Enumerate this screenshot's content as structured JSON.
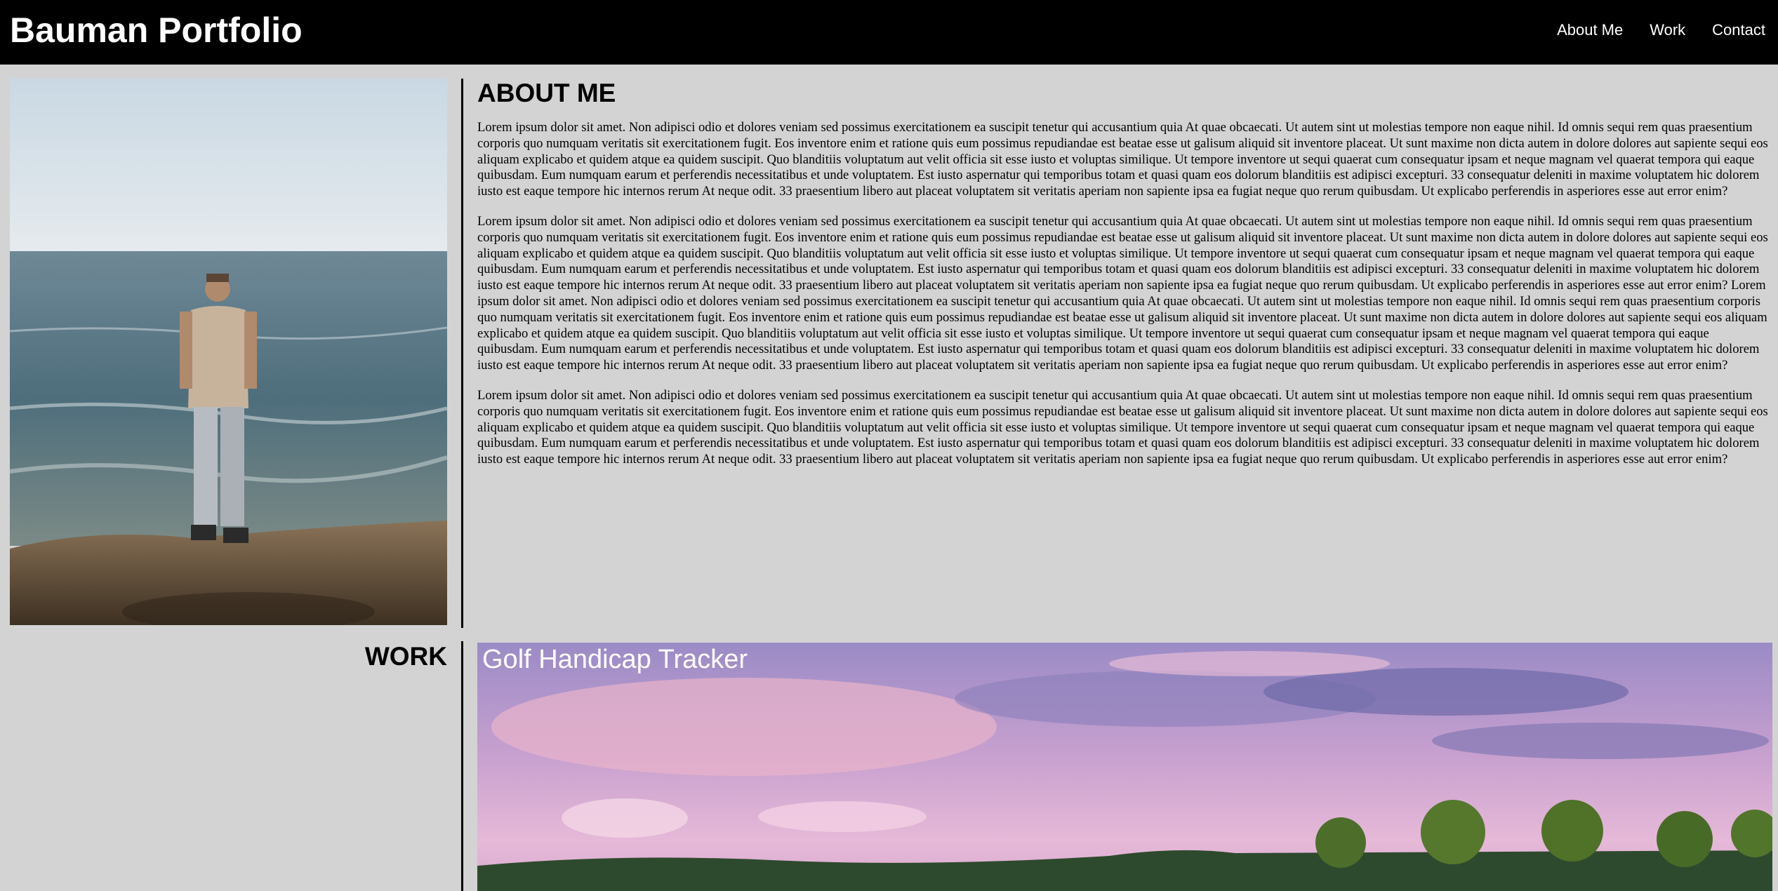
{
  "header": {
    "title": "Bauman Portfolio",
    "nav": [
      "About Me",
      "Work",
      "Contact"
    ]
  },
  "about": {
    "heading": "ABOUT ME",
    "paragraphs": [
      "Lorem ipsum dolor sit amet. Non adipisci odio et dolores veniam sed possimus exercitationem ea suscipit tenetur qui accusantium quia At quae obcaecati. Ut autem sint ut molestias tempore non eaque nihil. Id omnis sequi rem quas praesentium corporis quo numquam veritatis sit exercitationem fugit. Eos inventore enim et ratione quis eum possimus repudiandae est beatae esse ut galisum aliquid sit inventore placeat. Ut sunt maxime non dicta autem in dolore dolores aut sapiente sequi eos aliquam explicabo et quidem atque ea quidem suscipit. Quo blanditiis voluptatum aut velit officia sit esse iusto et voluptas similique. Ut tempore inventore ut sequi quaerat cum consequatur ipsam et neque magnam vel quaerat tempora qui eaque quibusdam. Eum numquam earum et perferendis necessitatibus et unde voluptatem. Est iusto aspernatur qui temporibus totam et quasi quam eos dolorum blanditiis est adipisci excepturi. 33 consequatur deleniti in maxime voluptatem hic dolorem iusto est eaque tempore hic internos rerum At neque odit. 33 praesentium libero aut placeat voluptatem sit veritatis aperiam non sapiente ipsa ea fugiat neque quo rerum quibusdam. Ut explicabo perferendis in asperiores esse aut error enim?",
      "Lorem ipsum dolor sit amet. Non adipisci odio et dolores veniam sed possimus exercitationem ea suscipit tenetur qui accusantium quia At quae obcaecati. Ut autem sint ut molestias tempore non eaque nihil. Id omnis sequi rem quas praesentium corporis quo numquam veritatis sit exercitationem fugit. Eos inventore enim et ratione quis eum possimus repudiandae est beatae esse ut galisum aliquid sit inventore placeat. Ut sunt maxime non dicta autem in dolore dolores aut sapiente sequi eos aliquam explicabo et quidem atque ea quidem suscipit. Quo blanditiis voluptatum aut velit officia sit esse iusto et voluptas similique. Ut tempore inventore ut sequi quaerat cum consequatur ipsam et neque magnam vel quaerat tempora qui eaque quibusdam. Eum numquam earum et perferendis necessitatibus et unde voluptatem. Est iusto aspernatur qui temporibus totam et quasi quam eos dolorum blanditiis est adipisci excepturi. 33 consequatur deleniti in maxime voluptatem hic dolorem iusto est eaque tempore hic internos rerum At neque odit. 33 praesentium libero aut placeat voluptatem sit veritatis aperiam non sapiente ipsa ea fugiat neque quo rerum quibusdam. Ut explicabo perferendis in asperiores esse aut error enim? Lorem ipsum dolor sit amet. Non adipisci odio et dolores veniam sed possimus exercitationem ea suscipit tenetur qui accusantium quia At quae obcaecati. Ut autem sint ut molestias tempore non eaque nihil. Id omnis sequi rem quas praesentium corporis quo numquam veritatis sit exercitationem fugit. Eos inventore enim et ratione quis eum possimus repudiandae est beatae esse ut galisum aliquid sit inventore placeat. Ut sunt maxime non dicta autem in dolore dolores aut sapiente sequi eos aliquam explicabo et quidem atque ea quidem suscipit. Quo blanditiis voluptatum aut velit officia sit esse iusto et voluptas similique. Ut tempore inventore ut sequi quaerat cum consequatur ipsam et neque magnam vel quaerat tempora qui eaque quibusdam. Eum numquam earum et perferendis necessitatibus et unde voluptatem. Est iusto aspernatur qui temporibus totam et quasi quam eos dolorum blanditiis est adipisci excepturi. 33 consequatur deleniti in maxime voluptatem hic dolorem iusto est eaque tempore hic internos rerum At neque odit. 33 praesentium libero aut placeat voluptatem sit veritatis aperiam non sapiente ipsa ea fugiat neque quo rerum quibusdam. Ut explicabo perferendis in asperiores esse aut error enim?",
      "Lorem ipsum dolor sit amet. Non adipisci odio et dolores veniam sed possimus exercitationem ea suscipit tenetur qui accusantium quia At quae obcaecati. Ut autem sint ut molestias tempore non eaque nihil. Id omnis sequi rem quas praesentium corporis quo numquam veritatis sit exercitationem fugit. Eos inventore enim et ratione quis eum possimus repudiandae est beatae esse ut galisum aliquid sit inventore placeat. Ut sunt maxime non dicta autem in dolore dolores aut sapiente sequi eos aliquam explicabo et quidem atque ea quidem suscipit. Quo blanditiis voluptatum aut velit officia sit esse iusto et voluptas similique. Ut tempore inventore ut sequi quaerat cum consequatur ipsam et neque magnam vel quaerat tempora qui eaque quibusdam. Eum numquam earum et perferendis necessitatibus et unde voluptatem. Est iusto aspernatur qui temporibus totam et quasi quam eos dolorum blanditiis est adipisci excepturi. 33 consequatur deleniti in maxime voluptatem hic dolorem iusto est eaque tempore hic internos rerum At neque odit. 33 praesentium libero aut placeat voluptatem sit veritatis aperiam non sapiente ipsa ea fugiat neque quo rerum quibusdam. Ut explicabo perferendis in asperiores esse aut error enim?"
    ]
  },
  "work": {
    "heading": "WORK",
    "projects": [
      {
        "title": "Golf Handicap Tracker"
      }
    ]
  },
  "colors": {
    "header_bg": "#000000",
    "page_bg": "#d3d3d3",
    "text": "#000000",
    "header_text": "#ffffff"
  }
}
